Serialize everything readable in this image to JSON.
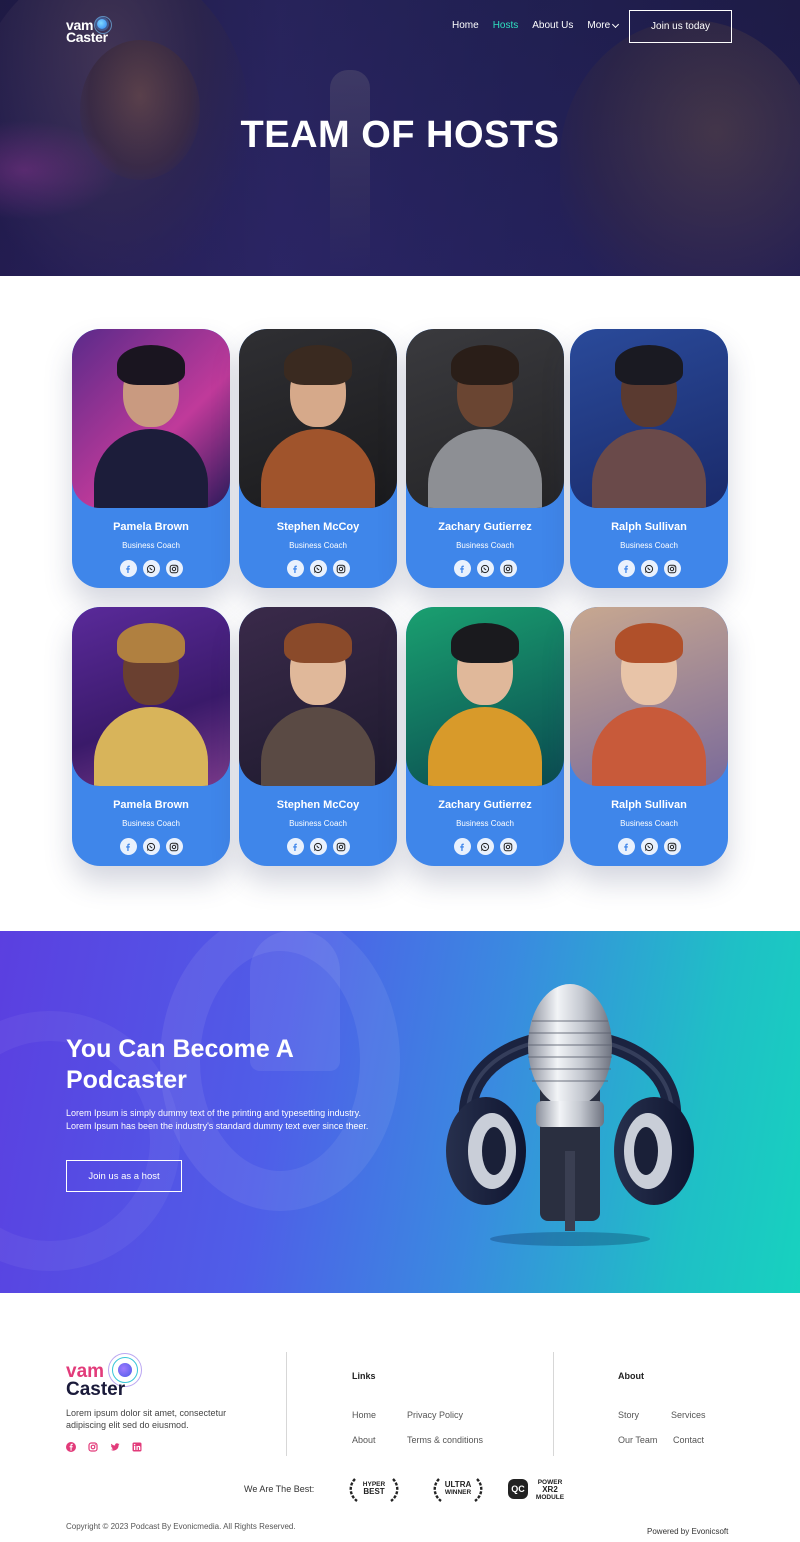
{
  "brand": {
    "logo_line1": "vam",
    "logo_line2": "Caster"
  },
  "nav": {
    "items": [
      {
        "label": "Home"
      },
      {
        "label": "Hosts",
        "active": true
      },
      {
        "label": "About Us"
      },
      {
        "label": "More"
      }
    ],
    "cta_label": "Join us today"
  },
  "hero": {
    "title": "TEAM OF HOSTS"
  },
  "hosts": [
    {
      "name": "Pamela Brown",
      "role": "Business Coach"
    },
    {
      "name": "Stephen McCoy",
      "role": "Business Coach"
    },
    {
      "name": "Zachary Gutierrez",
      "role": "Business Coach"
    },
    {
      "name": "Ralph Sullivan",
      "role": "Business Coach"
    },
    {
      "name": "Pamela Brown",
      "role": "Business Coach"
    },
    {
      "name": "Stephen McCoy",
      "role": "Business Coach"
    },
    {
      "name": "Zachary Gutierrez",
      "role": "Business Coach"
    },
    {
      "name": "Ralph Sullivan",
      "role": "Business Coach"
    }
  ],
  "host_social_icons": [
    "facebook-icon",
    "whatsapp-icon",
    "instagram-icon"
  ],
  "cta": {
    "title": "You Can Become A Podcaster",
    "text": "Lorem Ipsum is simply dummy text of the printing and typesetting industry. Lorem Ipsum has been the industry's standard dummy text ever since theer.",
    "button_label": "Join us as a host"
  },
  "footer": {
    "logo_line1": "vam",
    "logo_line2": "Caster",
    "description": "Lorem ipsum dolor sit amet, consectetur adipiscing elit  sed do eiusmod.",
    "social_icons": [
      "facebook-icon",
      "instagram-icon",
      "twitter-icon",
      "linkedin-icon"
    ],
    "links_heading": "Links",
    "links": [
      "Home",
      "Privacy Policy",
      "About",
      "Terms & conditions"
    ],
    "about_heading": "About",
    "about_links": [
      "Story",
      "Services",
      "Our Team",
      "Contact"
    ],
    "best_label": "We Are The Best:",
    "badges": [
      {
        "line1": "HYPER",
        "line2": "BEST"
      },
      {
        "line1": "ULTRA",
        "line2": "WINNER"
      }
    ],
    "qc_label": "QC",
    "power_label": [
      "POWER",
      "XR2",
      "MODULE"
    ],
    "copyright": "Copyright © 2023 Podcast By Evonicmedia. All Rights Reserved.",
    "powered_by": "Powered by Evonicsoft"
  },
  "colors": {
    "accent": "#3f86ea",
    "nav_active": "#2fe0c0",
    "brand_pink": "#e23b7a",
    "cta_gradient_start": "#5b3fe0",
    "cta_gradient_end": "#17d2bf"
  }
}
